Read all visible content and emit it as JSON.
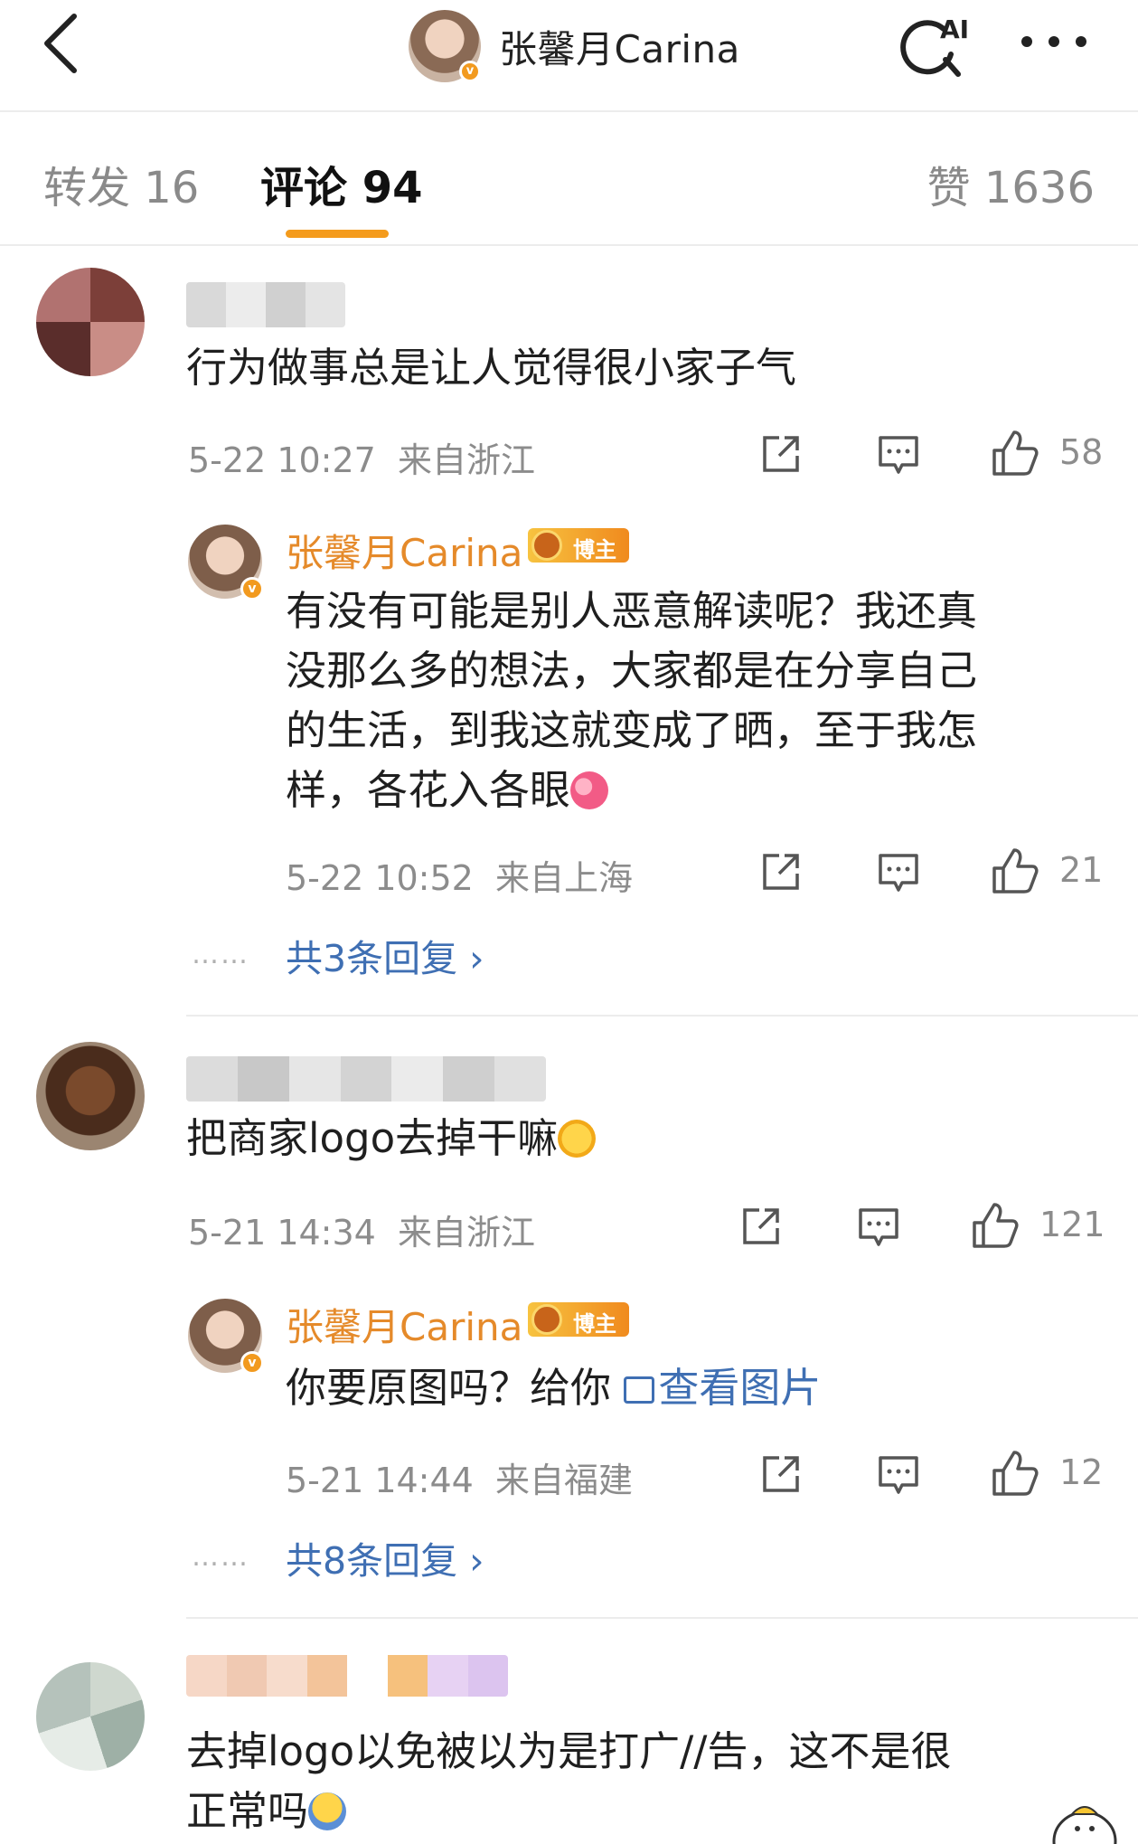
{
  "header": {
    "title": "张馨月Carina",
    "ai_label": "AI"
  },
  "tabs": {
    "forward": "转发 16",
    "comment": "评论 94",
    "like": "赞 1636"
  },
  "colors": {
    "accent": "#f49b1c",
    "link": "#3f6fb3",
    "author_name": "#e58a2a",
    "meta_gray": "#8c8c8c"
  },
  "comments": [
    {
      "text": "行为做事总是让人觉得很小家子气",
      "time": "5-22 10:27",
      "location": "来自浙江",
      "likes": "58",
      "reply": {
        "name": "张馨月Carina",
        "badge": "博主",
        "lines": [
          "有没有可能是别人恶意解读呢？我还真",
          "没那么多的想法，大家都是在分享自己",
          "的生活，到我这就变成了晒，至于我怎",
          "样，各花入各眼"
        ],
        "time": "5-22 10:52",
        "location": "来自上海",
        "likes": "21"
      },
      "more_replies": "共3条回复 ›",
      "dots": "……"
    },
    {
      "text": "把商家logo去掉干嘛",
      "time": "5-21 14:34",
      "location": "来自浙江",
      "likes": "121",
      "reply": {
        "name": "张馨月Carina",
        "badge": "博主",
        "text": "你要原图吗？给你 ",
        "link": "查看图片",
        "time": "5-21 14:44",
        "location": "来自福建",
        "likes": "12"
      },
      "more_replies": "共8条回复 ›",
      "dots": "……"
    },
    {
      "lines": [
        "去掉logo以免被以为是打广//告，这不是很",
        "正常吗"
      ]
    }
  ],
  "icons": [
    "back-icon",
    "ai-search-icon",
    "more-icon",
    "share-icon",
    "comment-icon",
    "like-icon",
    "image-icon"
  ]
}
